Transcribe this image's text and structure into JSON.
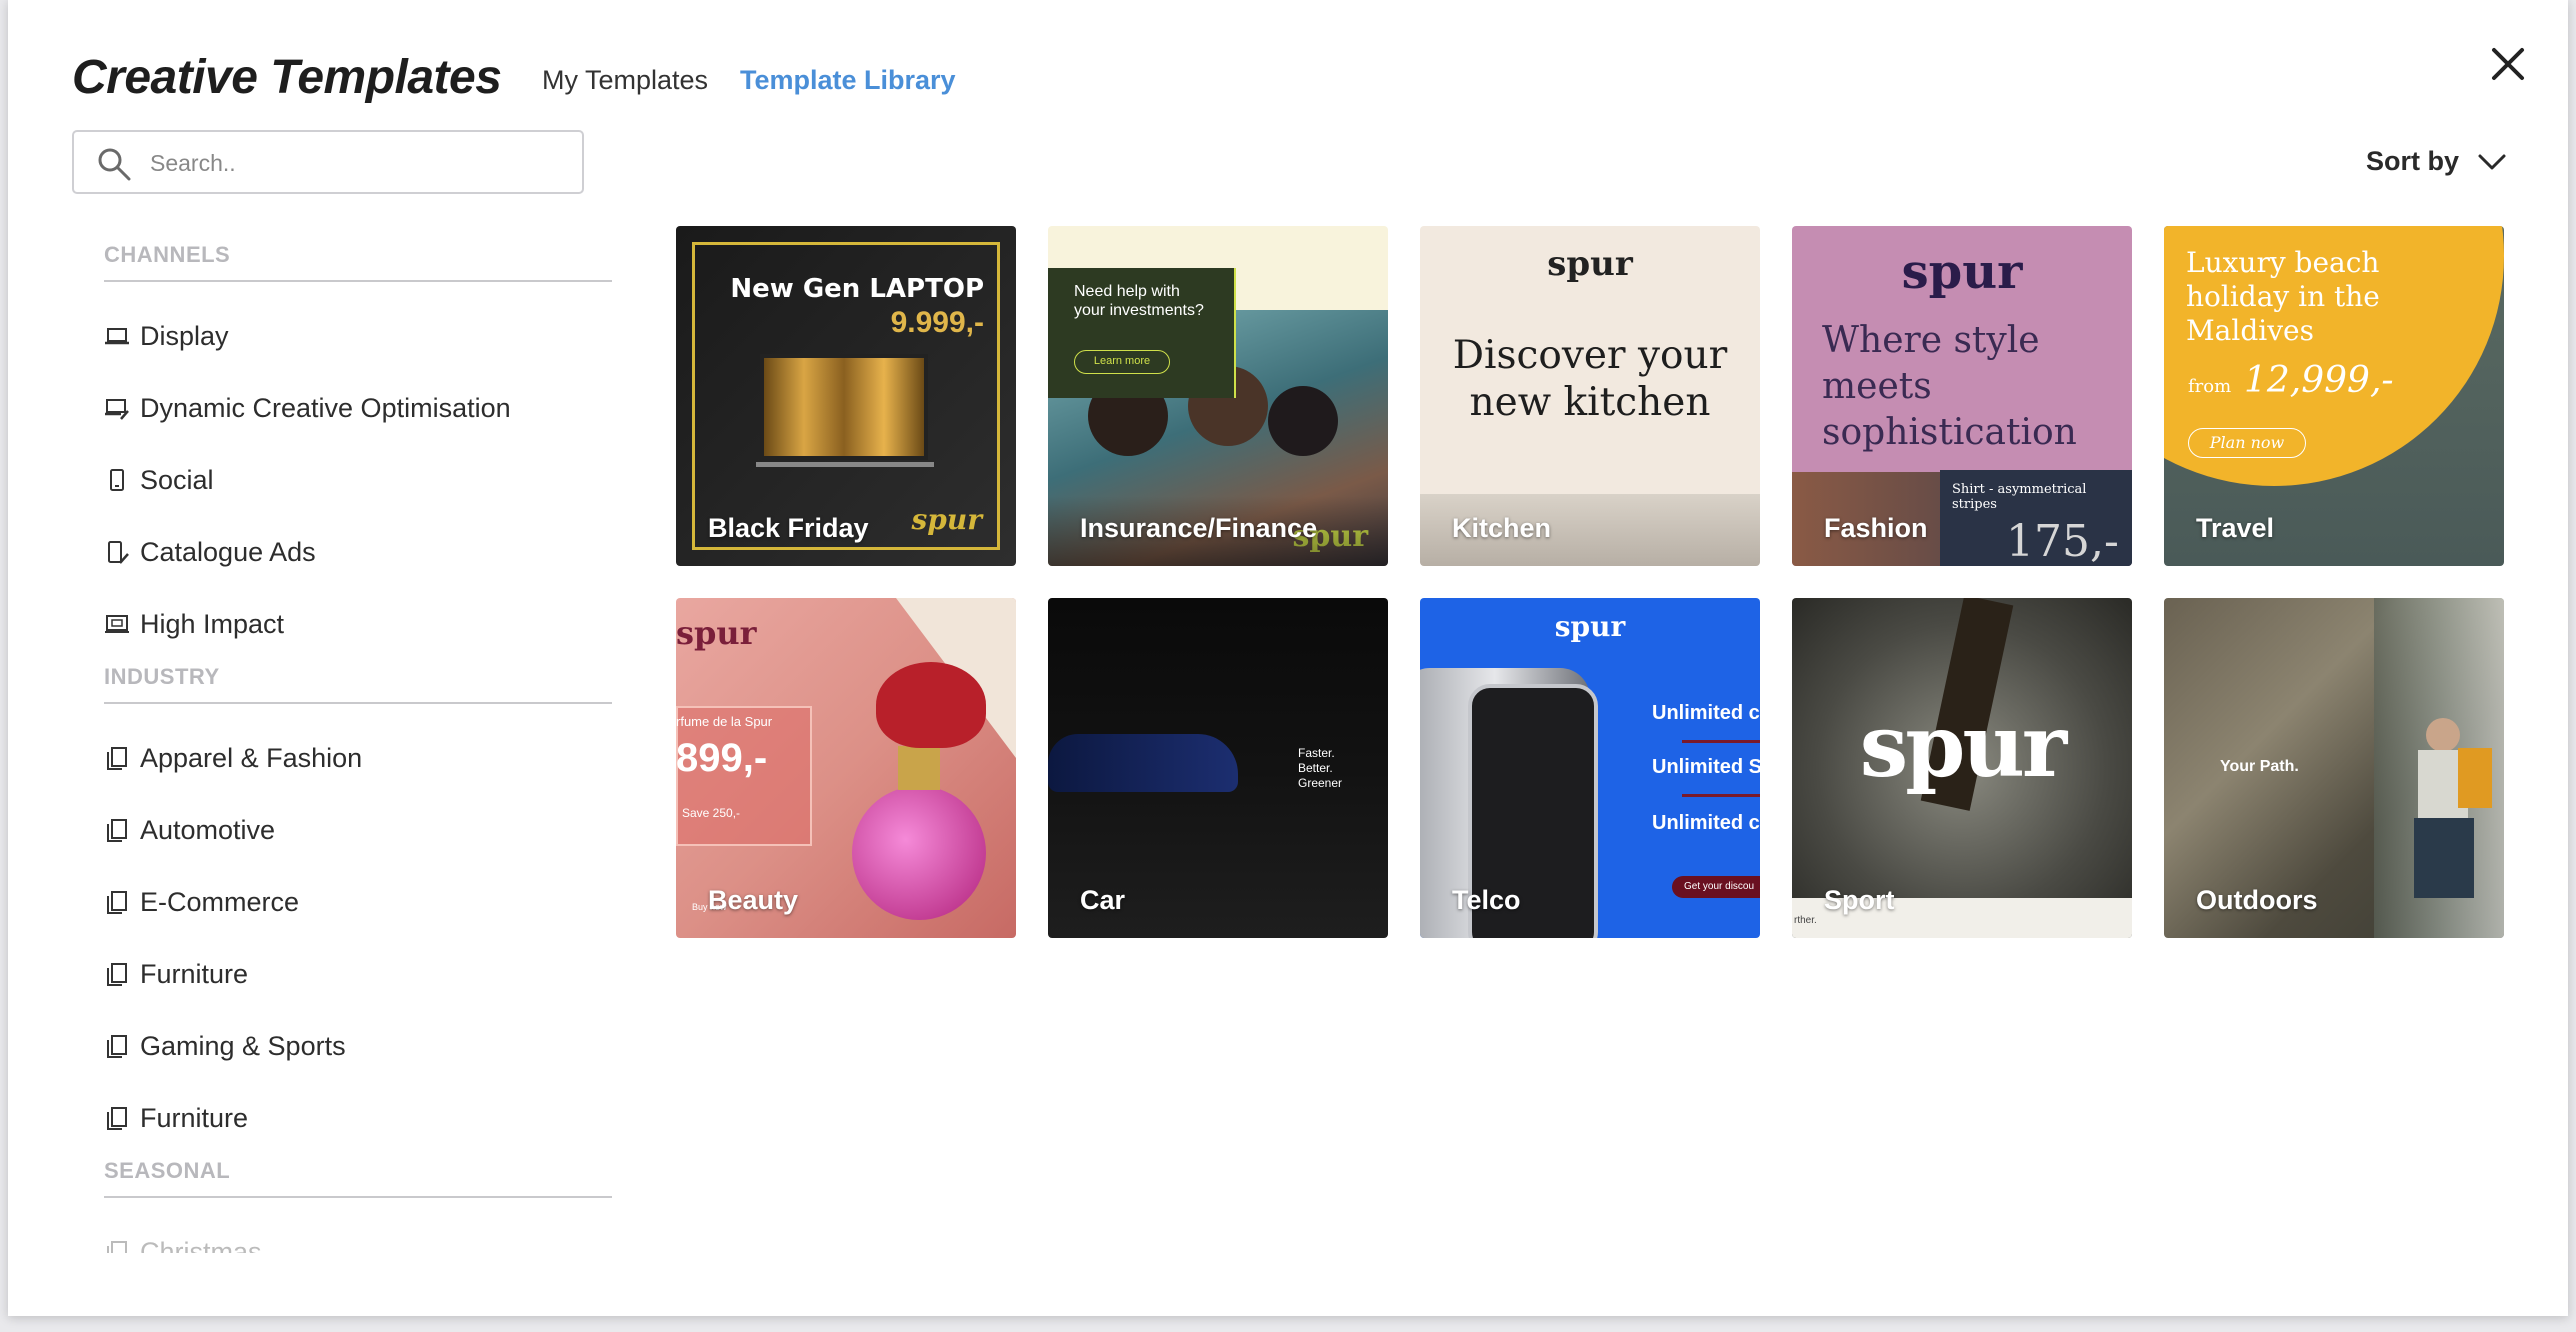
{
  "header": {
    "title": "Creative Templates",
    "tabs": [
      {
        "label": "My Templates",
        "active": false
      },
      {
        "label": "Template Library",
        "active": true
      }
    ],
    "close_icon": "close-icon"
  },
  "search": {
    "placeholder": "Search.."
  },
  "sort": {
    "label": "Sort by"
  },
  "colors": {
    "accent": "#4a8fd8",
    "text": "#2d2d2d",
    "muted": "#b8b8bc"
  },
  "sidebar": {
    "channels": {
      "title": "CHANNELS",
      "items": [
        {
          "label": "Display",
          "icon": "laptop-icon"
        },
        {
          "label": "Dynamic Creative Optimisation",
          "icon": "laptop-edit-icon"
        },
        {
          "label": "Social",
          "icon": "phone-icon"
        },
        {
          "label": "Catalogue Ads",
          "icon": "phone-edit-icon"
        },
        {
          "label": "High Impact",
          "icon": "screen-image-icon"
        }
      ]
    },
    "industry": {
      "title": "INDUSTRY",
      "items": [
        {
          "label": "Apparel & Fashion",
          "icon": "copy-icon"
        },
        {
          "label": "Automotive",
          "icon": "copy-icon"
        },
        {
          "label": "E-Commerce",
          "icon": "copy-icon"
        },
        {
          "label": "Furniture",
          "icon": "copy-icon"
        },
        {
          "label": "Gaming & Sports",
          "icon": "copy-icon"
        },
        {
          "label": "Furniture",
          "icon": "copy-icon"
        }
      ]
    },
    "seasonal": {
      "title": "SEASONAL",
      "items": [
        {
          "label": "Christmas",
          "icon": "copy-icon"
        }
      ]
    }
  },
  "templates": [
    {
      "label": "Black Friday",
      "headline": "New Gen LAPTOP",
      "price": "9.999,-",
      "brand": "spur"
    },
    {
      "label": "Insurance/Finance",
      "headline": "Need help with your investments?",
      "cta": "Learn more",
      "brand": "spur"
    },
    {
      "label": "Kitchen",
      "brand": "spur",
      "headline": "Discover your new kitchen"
    },
    {
      "label": "Fashion",
      "brand": "spur",
      "headline": "Where style meets sophistication",
      "product": "Shirt - asymmetrical stripes",
      "price": "175,-"
    },
    {
      "label": "Travel",
      "headline": "Luxury beach holiday in the Maldives",
      "prefix": "from",
      "price": "12,999,-",
      "cta": "Plan now"
    },
    {
      "label": "Beauty",
      "brand": "spur",
      "product": "rfume de la Spur",
      "price": "899,-",
      "save": "Save 250,-",
      "cta": "Buy now"
    },
    {
      "label": "Car",
      "tagline": [
        "Faster.",
        "Better.",
        "Greener"
      ]
    },
    {
      "label": "Telco",
      "brand": "spur",
      "lines": [
        "Unlimited c",
        "Unlimited S",
        "Unlimited c"
      ],
      "cta": "Get your discou"
    },
    {
      "label": "Sport",
      "brand": "spur",
      "footer": "rther."
    },
    {
      "label": "Outdoors",
      "headline": "Your Path."
    }
  ]
}
